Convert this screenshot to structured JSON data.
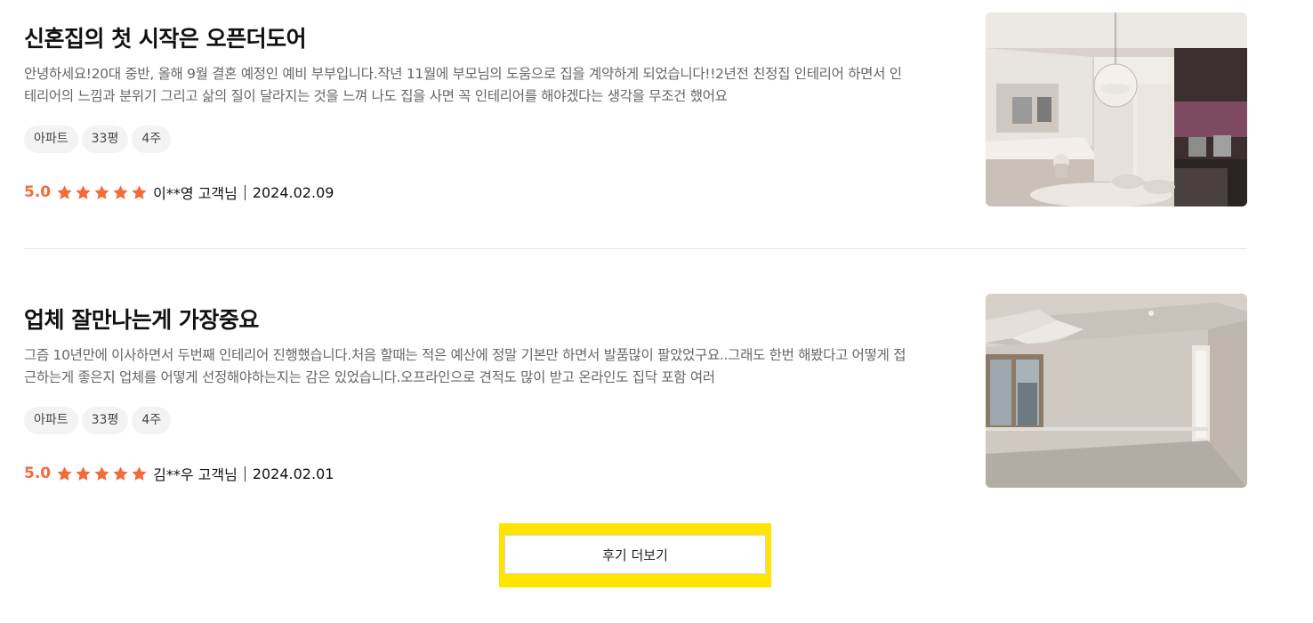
{
  "reviews": [
    {
      "title": "신혼집의 첫 시작은 오픈더도어",
      "body": "안녕하세요!20대 중반, 올해 9월 결혼 예정인 예비 부부입니다.작년 11월에 부모님의 도움으로 집을 계약하게 되었습니다!!2년전 친정집 인테리어 하면서 인테리어의 느낌과 분위기 그리고 삶의 질이 달라지는 것을 느껴 나도 집을 사면 꼭 인테리어를 해야겠다는 생각을 무조건 했어요",
      "tags": [
        "아파트",
        "33평",
        "4주"
      ],
      "score": "5.0",
      "rating": 5,
      "author": "이**영 고객님",
      "date": "2024.02.09",
      "image": "kitchen-photo"
    },
    {
      "title": "업체 잘만나는게 가장중요",
      "body": "그즘 10년만에 이사하면서 두번째 인테리어 진행했습니다.처음 할때는 적은 예산에 정말 기본만 하면서 발품많이 팔았었구요..그래도 한번 해봤다고 어떻게 접근하는게 좋은지 업체를 어떻게 선정해야하는지는 감은 있었습니다.오프라인으로 견적도 많이 받고 온라인도 집닥 포함 여러",
      "tags": [
        "아파트",
        "33평",
        "4주"
      ],
      "score": "5.0",
      "rating": 5,
      "author": "김**우 고객님",
      "date": "2024.02.01",
      "image": "living-room-photo"
    }
  ],
  "more_button": {
    "label": "후기 더보기"
  },
  "colors": {
    "accent": "#f26b3a",
    "highlight": "#ffe400"
  }
}
